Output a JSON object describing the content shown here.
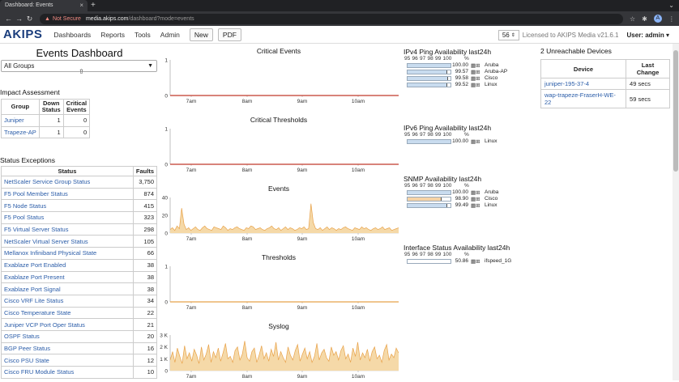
{
  "browser": {
    "tab_title": "Dashboard: Events",
    "tab_close": "×",
    "new_tab": "+",
    "tab_menu": "⌄",
    "not_secure": "Not Secure",
    "url_host": "media.akips.com",
    "url_path": "/dashboard?mode=events",
    "avatar": "A"
  },
  "header": {
    "logo": "AKIPS",
    "nav": [
      "Dashboards",
      "Reports",
      "Tools",
      "Admin"
    ],
    "buttons": [
      "New",
      "PDF"
    ],
    "count": "56",
    "license": "Licensed to AKIPS Media",
    "version": "v21.6.1",
    "user": "User: admin ▾"
  },
  "left": {
    "title": "Events Dashboard",
    "group_select": "All Groups",
    "impact_title": "Impact Assessment",
    "impact_headers": [
      "Group",
      "Down Status",
      "Critical Events"
    ],
    "impact_rows": [
      {
        "group": "Juniper",
        "down": "1",
        "critical": "0"
      },
      {
        "group": "Trapeze-AP",
        "down": "1",
        "critical": "0"
      }
    ],
    "status_title": "Status Exceptions",
    "status_headers": [
      "Status",
      "Faults"
    ],
    "status_rows": [
      {
        "status": "NetScaler Service Group Status",
        "faults": "3,750"
      },
      {
        "status": "F5 Pool Member Status",
        "faults": "874"
      },
      {
        "status": "F5 Node Status",
        "faults": "415"
      },
      {
        "status": "F5 Pool Status",
        "faults": "323"
      },
      {
        "status": "F5 Virtual Server Status",
        "faults": "298"
      },
      {
        "status": "NetScaler Virtual Server Status",
        "faults": "105"
      },
      {
        "status": "Mellanox Infiniband Physical State",
        "faults": "66"
      },
      {
        "status": "Exablaze Port Enabled",
        "faults": "38"
      },
      {
        "status": "Exablaze Port Present",
        "faults": "38"
      },
      {
        "status": "Exablaze Port Signal",
        "faults": "38"
      },
      {
        "status": "Cisco VRF Lite Status",
        "faults": "34"
      },
      {
        "status": "Cisco Temperature State",
        "faults": "22"
      },
      {
        "status": "Juniper VCP Port Oper Status",
        "faults": "21"
      },
      {
        "status": "OSPF Status",
        "faults": "20"
      },
      {
        "status": "BGP Peer Status",
        "faults": "16"
      },
      {
        "status": "Cisco PSU State",
        "faults": "12"
      },
      {
        "status": "Cisco FRU Module Status",
        "faults": "10"
      }
    ]
  },
  "chart_data": [
    {
      "type": "line",
      "title": "Critical Events",
      "x_ticks": [
        "7am",
        "8am",
        "9am",
        "10am"
      ],
      "y_ticks": [
        "0",
        "1"
      ],
      "ylim": [
        0,
        1
      ],
      "color": "#c0392b",
      "values": [
        0,
        0
      ]
    },
    {
      "type": "line",
      "title": "Critical Thresholds",
      "x_ticks": [
        "7am",
        "8am",
        "9am",
        "10am"
      ],
      "y_ticks": [
        "0",
        "1"
      ],
      "ylim": [
        0,
        1
      ],
      "color": "#c0392b",
      "values": [
        0,
        0
      ]
    },
    {
      "type": "area",
      "title": "Events",
      "x_ticks": [
        "7am",
        "8am",
        "9am",
        "10am"
      ],
      "y_ticks": [
        "0",
        "20",
        "40"
      ],
      "ylim": [
        0,
        40
      ],
      "color": "#e8a24a",
      "fill": "#f5d9a8",
      "values": [
        4,
        6,
        3,
        8,
        5,
        28,
        10,
        4,
        6,
        3,
        5,
        7,
        4,
        3,
        6,
        8,
        5,
        4,
        3,
        7,
        6,
        5,
        4,
        8,
        6,
        3,
        5,
        4,
        6,
        7,
        5,
        4,
        3,
        6,
        5,
        8,
        7,
        4,
        5,
        6,
        4,
        3,
        5,
        6,
        8,
        5,
        4,
        6,
        3,
        5,
        7,
        4,
        6,
        5,
        3,
        4,
        6,
        5,
        7,
        4,
        5,
        33,
        12,
        5,
        4,
        6,
        3,
        5,
        7,
        4,
        6,
        5,
        3,
        5,
        4,
        6,
        7,
        5,
        4,
        3,
        6,
        5,
        4,
        7,
        5,
        6,
        4,
        3,
        5,
        6,
        4,
        5,
        7,
        4,
        5,
        6,
        3,
        4,
        5,
        6
      ]
    },
    {
      "type": "line",
      "title": "Thresholds",
      "x_ticks": [
        "7am",
        "8am",
        "9am",
        "10am"
      ],
      "y_ticks": [
        "0",
        "1"
      ],
      "ylim": [
        0,
        1
      ],
      "color": "#e8a24a",
      "values": [
        0,
        0
      ]
    },
    {
      "type": "area",
      "title": "Syslog",
      "x_ticks": [
        "7am",
        "8am",
        "9am",
        "10am"
      ],
      "y_ticks": [
        "0",
        "1 K",
        "2 K",
        "3 K"
      ],
      "ylim": [
        0,
        3000
      ],
      "color": "#e8a24a",
      "fill": "#f5d9a8",
      "values": [
        900,
        1600,
        700,
        1900,
        1200,
        600,
        2100,
        1000,
        1500,
        800,
        1800,
        1300,
        600,
        2000,
        900,
        1400,
        2200,
        700,
        1600,
        1100,
        1900,
        800,
        1500,
        2300,
        1000,
        1200,
        700,
        1700,
        2000,
        900,
        1400,
        2500,
        1100,
        800,
        1600,
        1900,
        700,
        1300,
        2100,
        1000,
        1500,
        800,
        1800,
        1200,
        2400,
        900,
        1600,
        1100,
        700,
        2000,
        1300,
        900,
        1700,
        2200,
        800,
        1400,
        1900,
        1000,
        1600,
        700,
        1200,
        2300,
        900,
        1500,
        1800,
        1100,
        800,
        2000,
        1300,
        1600,
        900,
        1700,
        2100,
        1000,
        1400,
        700,
        1900,
        1200,
        2400,
        900,
        1500,
        1100,
        1800,
        800,
        1600,
        2000,
        1000,
        1300,
        700,
        1700,
        2200,
        900,
        1400,
        1100,
        1900,
        1500
      ]
    }
  ],
  "availability": {
    "scale": [
      "95",
      "96",
      "97",
      "98",
      "99",
      "100"
    ],
    "pct": "%",
    "ipv4": {
      "title": "IPv4 Ping Availability last24h",
      "rows": [
        {
          "value": "100.00",
          "name": "Aruba",
          "v": 100.0
        },
        {
          "value": "99.57",
          "name": "Aruba-AP",
          "v": 99.57
        },
        {
          "value": "99.58",
          "name": "Cisco",
          "v": 99.58
        },
        {
          "value": "99.52",
          "name": "Linux",
          "v": 99.52
        }
      ]
    },
    "ipv6": {
      "title": "IPv6 Ping Availability last24h",
      "rows": [
        {
          "value": "100.00",
          "name": "Linux",
          "v": 100.0
        }
      ]
    },
    "snmp": {
      "title": "SNMP Availability last24h",
      "rows": [
        {
          "value": "100.00",
          "name": "Aruba",
          "v": 100.0
        },
        {
          "value": "98.90",
          "name": "Cisco",
          "v": 98.9
        },
        {
          "value": "99.49",
          "name": "Linux",
          "v": 99.49
        }
      ]
    },
    "iface": {
      "title": "Interface Status Availability last24h",
      "rows": [
        {
          "value": "50.86",
          "name": "ifspeed_1G",
          "v": 50.86
        }
      ]
    }
  },
  "unreachable": {
    "title": "2 Unreachable Devices",
    "headers": [
      "Device",
      "Last Change"
    ],
    "rows": [
      {
        "device": "juniper-195-37-4",
        "change": "49 secs"
      },
      {
        "device": "wap-trapeze-FraserH-WE-22",
        "change": "59 secs"
      }
    ]
  },
  "colors": {
    "bar_blue": "#c9dcef",
    "bar_orange": "#f6d3a6",
    "accent": "#1a3d7c"
  }
}
